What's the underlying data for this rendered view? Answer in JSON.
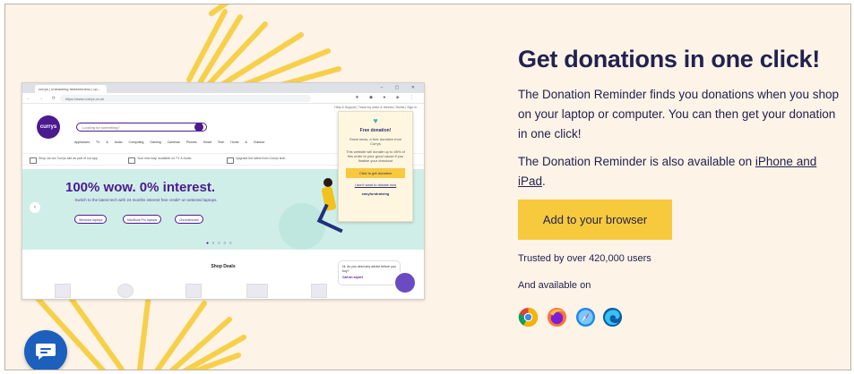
{
  "heading": "Get donations in one click!",
  "description": "The Donation Reminder finds you donations when you shop on your laptop or computer. You can then get your donation in one click!",
  "availability": {
    "prefix": "The Donation Reminder is also available on ",
    "link": "iPhone and iPad",
    "suffix": "."
  },
  "cta_label": "Add to your browser",
  "trusted_text": "Trusted by over 420,000 users",
  "available_on_label": "And available on",
  "browsers": [
    "chrome-icon",
    "firefox-icon",
    "safari-icon",
    "edge-icon"
  ],
  "colors": {
    "background": "#fdf3e7",
    "navy": "#22224f",
    "yellow": "#f7c93d",
    "chat_blue": "#1d5fbd"
  },
  "screenshot": {
    "tab_title": "currys | unleashing fantasticness | up...",
    "url": "https://www.currys.co.uk",
    "top_strip": "Help & Support | Track my order & returns | Stores | Sign in",
    "logo": "currys",
    "search_placeholder": "Looking for something?",
    "categories": "Appliances   TV & Audio   Computing   Gaming   Cameras   Phones   Smart Tech   Home & Outdoor",
    "benefits": [
      "Shop via our Currys site as part of our app",
      "Your new way, available on TV & Audio",
      "Upgrade the latest from Currys tech"
    ],
    "hero_title": "100% wow. 0% interest.",
    "hero_sub": "Switch to the latest tech with 24 months interest free credit* on selected laptops.",
    "hero_pills": [
      "Windows laptops",
      "MacBook Pro laptops",
      "Chromebooks"
    ],
    "shop_deals": "Shop Deals",
    "popup": {
      "title": "Free donation!",
      "text1": "Great news, a free donation from Currys",
      "text2": "This website will donate up to 45% of this order to your good cause if you finalise your checkout",
      "button": "Click to get donation",
      "link": "I don't want to donate now",
      "brand": "easyfundraising"
    },
    "chat": {
      "text": "Hi, do you need any advice before you buy?",
      "link": "Call an expert"
    }
  }
}
